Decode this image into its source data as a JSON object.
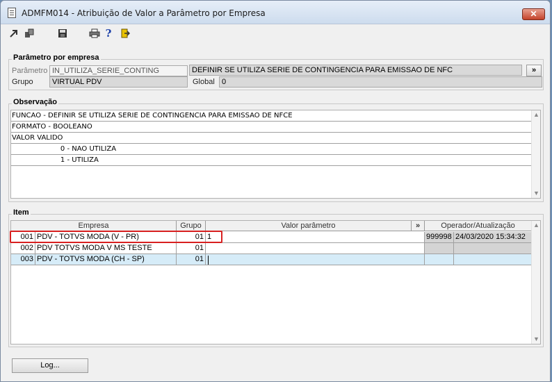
{
  "window": {
    "title": "ADMFM014 - Atribuição de Valor a Parâmetro por Empresa",
    "close_glyph": "✕"
  },
  "toolbar": {
    "icons": [
      "move-icon",
      "copy-icon",
      "save-icon",
      "print-icon",
      "help-icon",
      "exit-icon"
    ]
  },
  "parametro_group": {
    "title": "Parâmetro por empresa",
    "parametro_label": "Parâmetro",
    "parametro_value": "IN_UTILIZA_SERIE_CONTING",
    "descricao_value": "DEFINIR SE UTILIZA SERIE DE CONTINGENCIA PARA EMISSAO DE NFC",
    "expand_label": "»",
    "grupo_label": "Grupo",
    "grupo_value": "VIRTUAL PDV",
    "global_label": "Global",
    "global_value": "0"
  },
  "observacao_group": {
    "title": "Observação",
    "lines": [
      "FUNCAO - DEFINIR SE UTILIZA SERIE DE CONTINGENCIA PARA EMISSAO DE NFCE",
      "FORMATO - BOOLEANO",
      "VALOR VALIDO",
      "                      0 - NAO UTILIZA",
      "                      1 - UTILIZA"
    ]
  },
  "item_group": {
    "title": "Item",
    "columns": {
      "empresa": "Empresa",
      "grupo": "Grupo",
      "valor": "Valor parâmetro",
      "expand": "»",
      "operador": "Operador/Atualização"
    },
    "rows": [
      {
        "code": "001",
        "empresa": "PDV - TOTVS MODA (V - PR)",
        "grupo": "01",
        "valor": "1",
        "operador": "999998",
        "atualizacao": "24/03/2020 15:34:32"
      },
      {
        "code": "002",
        "empresa": "PDV TOTVS MODA V MS TESTE",
        "grupo": "01",
        "valor": "",
        "operador": "",
        "atualizacao": ""
      },
      {
        "code": "003",
        "empresa": "PDV - TOTVS MODA (CH - SP)",
        "grupo": "01",
        "valor": "",
        "operador": "",
        "atualizacao": ""
      }
    ]
  },
  "footer": {
    "log_label": "Log..."
  },
  "colors": {
    "highlight": "#d82020",
    "selected_row": "#d6ecf8",
    "title_bar": "#cddcee"
  }
}
